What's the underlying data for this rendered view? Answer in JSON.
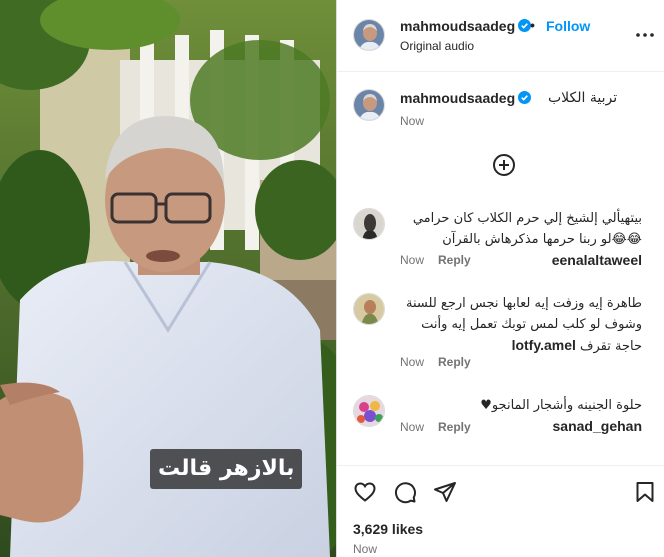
{
  "header": {
    "username": "mahmoudsaadeg",
    "separator": "•",
    "follow_label": "Follow",
    "subtitle": "Original audio"
  },
  "caption": {
    "username": "mahmoudsaadeg",
    "text": "تربية الكلاب",
    "time": "Now"
  },
  "video": {
    "caption_text": "بالازهر قالت"
  },
  "comments": [
    {
      "username": "eenalaltaweel",
      "text": "بيتهيألي إلشيخ إلي حرم الكلاب كان حرامي 😂😂لو ربنا حرمها مذكرهاش بالقرآن",
      "time": "Now",
      "reply_label": "Reply"
    },
    {
      "username": "lotfy.amel",
      "text": "طاهرة إيه وزفت إيه لعابها نجس ارجع للسنة وشوف لو كلب لمس توبك تعمل إيه وأنت حاجة تقرف",
      "time": "Now",
      "reply_label": "Reply"
    },
    {
      "username": "sanad_gehan",
      "text": "حلوة الجنينه وأشجار المانجو♥",
      "time": "Now",
      "reply_label": "Reply"
    }
  ],
  "footer": {
    "likes": "3,629 likes",
    "time": "Now"
  },
  "icons": {
    "more": "more-horizontal-icon",
    "verified": "verified-badge-icon",
    "load_more": "plus-circle-icon",
    "like": "heart-icon",
    "comment": "comment-icon",
    "share": "send-icon",
    "save": "bookmark-icon"
  },
  "colors": {
    "accent": "#0095f6",
    "text": "#262626",
    "muted": "#737373"
  }
}
